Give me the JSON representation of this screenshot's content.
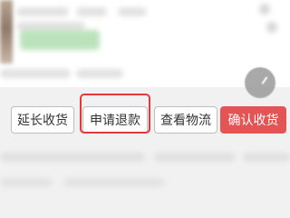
{
  "actions": {
    "extend_label": "延长收货",
    "refund_label": "申请退款",
    "logistics_label": "查看物流",
    "confirm_label": "确认收货"
  },
  "colors": {
    "confirm_bg": "#e45454",
    "highlight": "#e03a3a"
  },
  "icons": {
    "floating": "gray-circle-icon"
  }
}
